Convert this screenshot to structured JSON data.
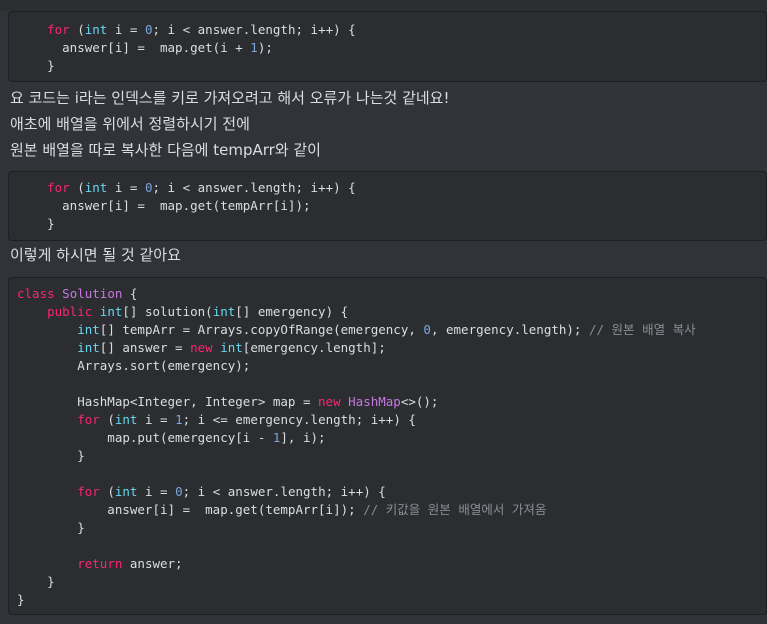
{
  "colors": {
    "background": "#313338",
    "code_background": "#2b2d31",
    "text": "#dbdee1",
    "keyword": "#f92672",
    "type": "#66d9ef",
    "class_name": "#c678dd",
    "number": "#7aa6da",
    "comment": "#8a8d93"
  },
  "code_block_1": {
    "lines": [
      [
        {
          "t": "    "
        },
        {
          "t": "for",
          "c": "kw"
        },
        {
          "t": " ("
        },
        {
          "t": "int",
          "c": "tp"
        },
        {
          "t": " i = "
        },
        {
          "t": "0",
          "c": "num"
        },
        {
          "t": "; i < answer.length; i++) {"
        }
      ],
      [
        {
          "t": "      answer[i] =  map.get(i + "
        },
        {
          "t": "1",
          "c": "num"
        },
        {
          "t": ");"
        }
      ],
      [
        {
          "t": "    }"
        }
      ]
    ]
  },
  "messages": {
    "line1": "요 코드는 i라는 인덱스를 키로 가져오려고 해서 오류가 나는것 같네요!",
    "line2": "애초에 배열을 위에서 정렬하시기 전에",
    "line3": "원본 배열을 따로 복사한 다음에 tempArr와 같이",
    "line4": "이렇게 하시면 될 것 같아요"
  },
  "code_block_2": {
    "lines": [
      [
        {
          "t": "    "
        },
        {
          "t": "for",
          "c": "kw"
        },
        {
          "t": " ("
        },
        {
          "t": "int",
          "c": "tp"
        },
        {
          "t": " i = "
        },
        {
          "t": "0",
          "c": "num"
        },
        {
          "t": "; i < answer.length; i++) {"
        }
      ],
      [
        {
          "t": "      answer[i] =  map.get(tempArr[i]);"
        }
      ],
      [
        {
          "t": "    }"
        }
      ]
    ]
  },
  "code_block_3": {
    "lines": [
      [
        {
          "t": "class",
          "c": "kw"
        },
        {
          "t": " "
        },
        {
          "t": "Solution",
          "c": "cls"
        },
        {
          "t": " {"
        }
      ],
      [
        {
          "t": "    "
        },
        {
          "t": "public",
          "c": "kw"
        },
        {
          "t": " "
        },
        {
          "t": "int",
          "c": "tp"
        },
        {
          "t": "[] solution("
        },
        {
          "t": "int",
          "c": "tp"
        },
        {
          "t": "[] emergency) {"
        }
      ],
      [
        {
          "t": "        "
        },
        {
          "t": "int",
          "c": "tp"
        },
        {
          "t": "[] tempArr = Arrays.copyOfRange(emergency, "
        },
        {
          "t": "0",
          "c": "num"
        },
        {
          "t": ", emergency.length); "
        },
        {
          "t": "// 원본 배열 복사",
          "c": "cm"
        }
      ],
      [
        {
          "t": "        "
        },
        {
          "t": "int",
          "c": "tp"
        },
        {
          "t": "[] answer = "
        },
        {
          "t": "new",
          "c": "kw"
        },
        {
          "t": " "
        },
        {
          "t": "int",
          "c": "tp"
        },
        {
          "t": "[emergency.length];"
        }
      ],
      [
        {
          "t": "        Arrays.sort(emergency);"
        }
      ],
      [
        {
          "t": ""
        }
      ],
      [
        {
          "t": "        HashMap<Integer, Integer> map = "
        },
        {
          "t": "new",
          "c": "kw"
        },
        {
          "t": " "
        },
        {
          "t": "HashMap",
          "c": "cls"
        },
        {
          "t": "<>();"
        }
      ],
      [
        {
          "t": "        "
        },
        {
          "t": "for",
          "c": "kw"
        },
        {
          "t": " ("
        },
        {
          "t": "int",
          "c": "tp"
        },
        {
          "t": " i = "
        },
        {
          "t": "1",
          "c": "num"
        },
        {
          "t": "; i <= emergency.length; i++) {"
        }
      ],
      [
        {
          "t": "            map.put(emergency[i - "
        },
        {
          "t": "1",
          "c": "num"
        },
        {
          "t": "], i);"
        }
      ],
      [
        {
          "t": "        }"
        }
      ],
      [
        {
          "t": ""
        }
      ],
      [
        {
          "t": "        "
        },
        {
          "t": "for",
          "c": "kw"
        },
        {
          "t": " ("
        },
        {
          "t": "int",
          "c": "tp"
        },
        {
          "t": " i = "
        },
        {
          "t": "0",
          "c": "num"
        },
        {
          "t": "; i < answer.length; i++) {"
        }
      ],
      [
        {
          "t": "            answer[i] =  map.get(tempArr[i]); "
        },
        {
          "t": "// 키값을 원본 배열에서 가져옴",
          "c": "cm"
        }
      ],
      [
        {
          "t": "        }"
        }
      ],
      [
        {
          "t": ""
        }
      ],
      [
        {
          "t": "        "
        },
        {
          "t": "return",
          "c": "kw"
        },
        {
          "t": " answer;"
        }
      ],
      [
        {
          "t": "    }"
        }
      ],
      [
        {
          "t": "}"
        }
      ]
    ]
  }
}
